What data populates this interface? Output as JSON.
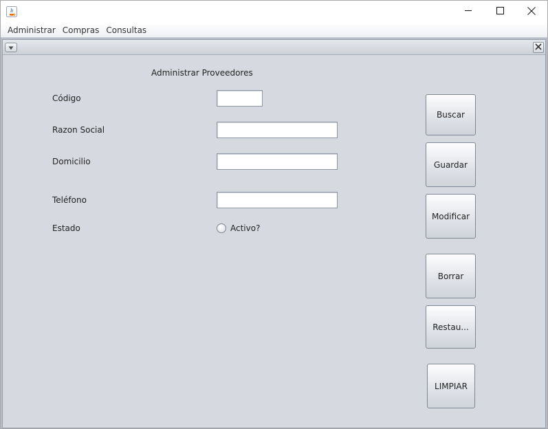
{
  "window": {
    "icon": "java-icon",
    "controls": {
      "minimize": "minimize-icon",
      "maximize": "maximize-icon",
      "close": "close-icon"
    }
  },
  "menubar": {
    "items": [
      {
        "label": "Administrar"
      },
      {
        "label": "Compras"
      },
      {
        "label": "Consultas"
      }
    ]
  },
  "frame": {
    "system_menu_icon": "chevron-down-icon",
    "close_icon": "close-icon",
    "title": "Administrar Proveedores"
  },
  "form": {
    "codigo_label": "Código",
    "codigo_value": "",
    "razon_social_label": "Razon Social",
    "razon_social_value": "",
    "domicilio_label": "Domicilio",
    "domicilio_value": "",
    "telefono_label": "Teléfono",
    "telefono_value": "",
    "estado_label": "Estado",
    "activo_label": "Activo?",
    "activo_checked": false
  },
  "buttons": {
    "buscar": "Buscar",
    "guardar": "Guardar",
    "modificar": "Modificar",
    "borrar": "Borrar",
    "restaurar": "Restau...",
    "limpiar": "LIMPIAR"
  },
  "colors": {
    "panel_bg": "#d6d9df",
    "desktop_bg": "#b8bcc6"
  }
}
